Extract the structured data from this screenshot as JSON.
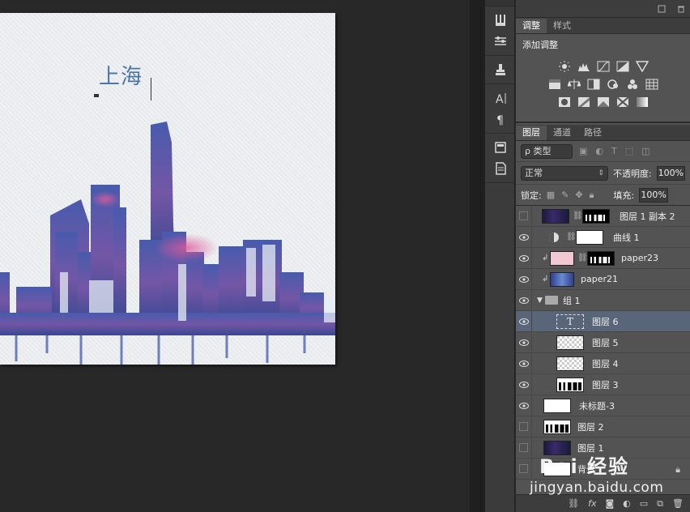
{
  "canvas": {
    "text": "上海"
  },
  "adjust_panel": {
    "tabs": [
      "调整",
      "样式"
    ],
    "title": "添加调整"
  },
  "layers_panel": {
    "tabs": [
      "图层",
      "通道",
      "路径"
    ],
    "filter_kind": "ρ 类型",
    "blend_mode": "正常",
    "opacity_label": "不透明度:",
    "opacity_value": "100%",
    "lock_label": "锁定:",
    "fill_label": "填充:",
    "fill_value": "100%",
    "layers": [
      {
        "name": "图层 1 副本 2",
        "visible": false
      },
      {
        "name": "曲线 1",
        "visible": true
      },
      {
        "name": "paper23",
        "visible": true
      },
      {
        "name": "paper21",
        "visible": true
      },
      {
        "name": "组 1",
        "visible": true
      },
      {
        "name": "图层 6",
        "visible": true,
        "selected": true
      },
      {
        "name": "图层 5",
        "visible": true
      },
      {
        "name": "图层 4",
        "visible": true
      },
      {
        "name": "图层 3",
        "visible": true
      },
      {
        "name": "未标题-3",
        "visible": true
      },
      {
        "name": "图层 2",
        "visible": false
      },
      {
        "name": "图层 1",
        "visible": false
      },
      {
        "name": "背景",
        "visible": false
      }
    ]
  },
  "watermark": {
    "logo": "Bai 经验",
    "url": "jingyan.baidu.com"
  },
  "colors": {
    "panel_bg": "#535353",
    "selected_row": "#596679",
    "canvas_bg": "#282828",
    "text_blue": "#4a76a8"
  }
}
